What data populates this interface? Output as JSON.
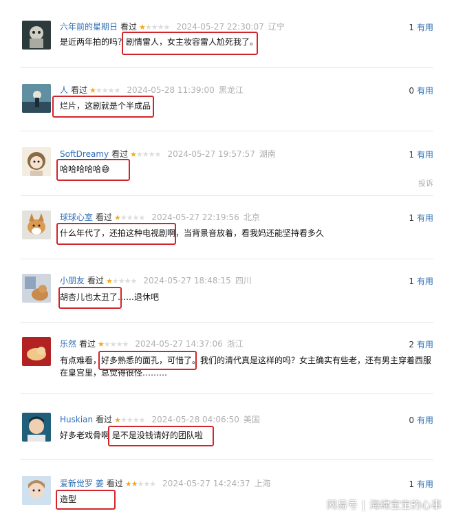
{
  "comments": [
    {
      "user": "六年前的星期日",
      "action": "看过",
      "rating": 1,
      "date": "2024-05-27 22:30:07",
      "location": "辽宁",
      "useful_count": "1",
      "useful_label": "有用",
      "text": "是近两年拍的吗？剧情雷人，女主妆容雷人尬死我了。"
    },
    {
      "user": "人",
      "action": "看过",
      "rating": 1,
      "date": "2024-05-28 11:39:00",
      "location": "黑龙江",
      "useful_count": "0",
      "useful_label": "有用",
      "text": "烂片，这剧就是个半成品"
    },
    {
      "user": "SoftDreamy",
      "action": "看过",
      "rating": 1,
      "date": "2024-05-27 19:57:57",
      "location": "湖南",
      "useful_count": "1",
      "useful_label": "有用",
      "text": "哈哈哈哈哈😅",
      "report": "投诉"
    },
    {
      "user": "球球心室",
      "action": "看过",
      "rating": 1,
      "date": "2024-05-27 22:19:56",
      "location": "北京",
      "useful_count": "1",
      "useful_label": "有用",
      "text": "什么年代了，还拍这种电视剧啊，当背景音放着，看我妈还能坚持看多久"
    },
    {
      "user": "小朋友",
      "action": "看过",
      "rating": 1,
      "date": "2024-05-27 18:48:15",
      "location": "四川",
      "useful_count": "1",
      "useful_label": "有用",
      "text": "胡杏儿也太丑了……退休吧"
    },
    {
      "user": "乐然",
      "action": "看过",
      "rating": 1,
      "date": "2024-05-27 14:37:06",
      "location": "浙江",
      "useful_count": "2",
      "useful_label": "有用",
      "text": "有点难看，好多熟悉的面孔，可惜了。我们的清代真是这样的吗？女主确实有些老，还有男主穿着西服在皇宫里，总觉得很怪………"
    },
    {
      "user": "Huskian",
      "action": "看过",
      "rating": 1,
      "date": "2024-05-28 04:06:50",
      "location": "美国",
      "useful_count": "0",
      "useful_label": "有用",
      "text": "好多老戏骨啊 是不是没钱请好的团队啦"
    },
    {
      "user": "爱新觉罗 姜",
      "action": "看过",
      "rating": 2,
      "date": "2024-05-27 14:24:37",
      "location": "上海",
      "useful_count": "1",
      "useful_label": "有用",
      "text": "造型"
    }
  ],
  "watermark": {
    "platform": "网易号",
    "separator": "|",
    "author": "海绵宝宝的心事"
  },
  "colors": {
    "highlight": "#d2252b",
    "username": "#2f6fb5",
    "star": "#f5a623"
  }
}
